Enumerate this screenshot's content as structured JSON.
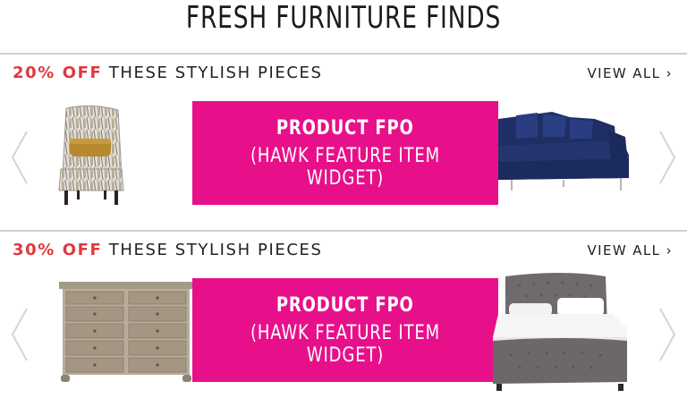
{
  "page": {
    "title": "FRESH FURNITURE FINDS"
  },
  "sections": [
    {
      "discount": "20% OFF",
      "heading": "THESE STYLISH PIECES",
      "view_all": "VIEW ALL",
      "promo_line1": "PRODUCT FPO",
      "promo_line2": "(HAWK FEATURE ITEM WIDGET)",
      "left_product": "accent-chair-image",
      "right_product": "blue-sectional-sofa-image"
    },
    {
      "discount": "30% OFF",
      "heading": "THESE STYLISH PIECES",
      "view_all": "VIEW ALL",
      "promo_line1": "PRODUCT FPO",
      "promo_line2": "(HAWK FEATURE ITEM WIDGET)",
      "left_product": "wood-dresser-image",
      "right_product": "tufted-grey-bed-image"
    }
  ],
  "colors": {
    "accent_red": "#e0393e",
    "promo_magenta": "#e8108a",
    "divider": "#cfcfcf",
    "arrow": "#d4d4d4"
  },
  "icons": {
    "prev": "chevron-left-icon",
    "next": "chevron-right-icon",
    "view_all_arrow": "chevron-right-icon"
  }
}
